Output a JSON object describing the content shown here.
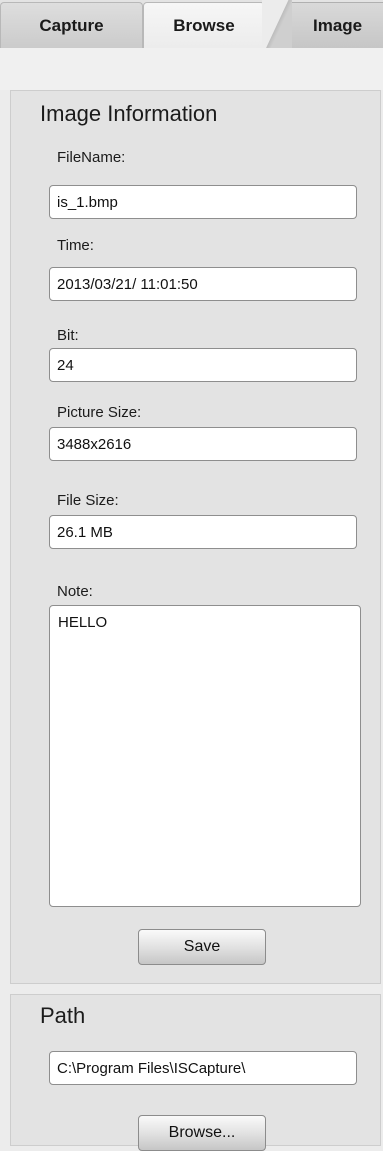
{
  "tabs": {
    "capture": "Capture",
    "browse": "Browse",
    "image": "Image"
  },
  "image_info": {
    "title": "Image Information",
    "filename_label": "FileName:",
    "filename_value": "is_1.bmp",
    "time_label": "Time:",
    "time_value": "2013/03/21/ 11:01:50",
    "bit_label": "Bit:",
    "bit_value": "24",
    "picture_size_label": "Picture Size:",
    "picture_size_value": "3488x2616",
    "file_size_label": "File Size:",
    "file_size_value": "26.1 MB",
    "note_label": "Note:",
    "note_value": "HELLO",
    "save_label": "Save"
  },
  "path": {
    "title": "Path",
    "value": "C:\\Program Files\\ISCapture\\",
    "browse_label": "Browse..."
  }
}
